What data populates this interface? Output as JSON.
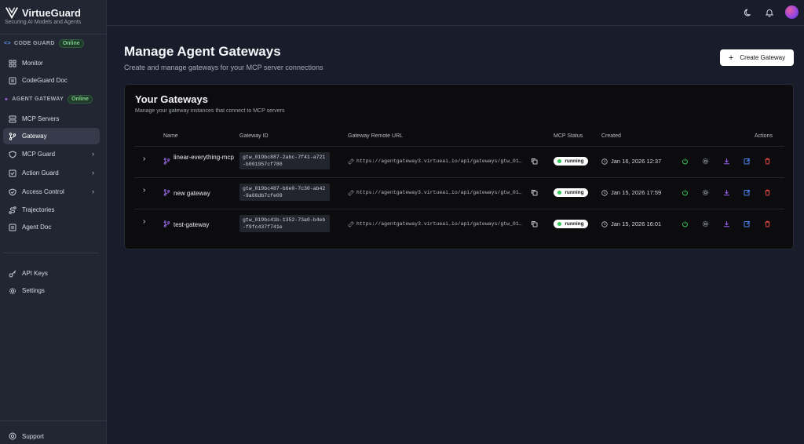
{
  "brand": {
    "name": "VirtueGuard",
    "tagline": "Securing AI Models and Agents"
  },
  "sidebar": {
    "code_guard": {
      "label": "CODE GUARD",
      "badge": "Online",
      "items": [
        {
          "label": "Monitor",
          "icon": "grid-icon"
        },
        {
          "label": "CodeGuard Doc",
          "icon": "document-icon"
        }
      ]
    },
    "agent_gateway": {
      "label": "AGENT GATEWAY",
      "badge": "Online",
      "items": [
        {
          "label": "MCP Servers",
          "icon": "server-icon"
        },
        {
          "label": "Gateway",
          "icon": "branch-icon",
          "active": true
        },
        {
          "label": "MCP Guard",
          "icon": "shield-icon",
          "expandable": true
        },
        {
          "label": "Action Guard",
          "icon": "square-check-icon",
          "expandable": true
        },
        {
          "label": "Access Control",
          "icon": "shield-check-icon",
          "expandable": true
        },
        {
          "label": "Trajectories",
          "icon": "route-icon"
        },
        {
          "label": "Agent Doc",
          "icon": "document-icon"
        }
      ]
    },
    "settings_items": [
      {
        "label": "API Keys",
        "icon": "key-icon"
      },
      {
        "label": "Settings",
        "icon": "gear-icon"
      }
    ],
    "support": {
      "label": "Support",
      "icon": "lifebuoy-icon"
    }
  },
  "header": {
    "title": "Manage Agent Gateways",
    "subtitle": "Create and manage gateways for your MCP server connections",
    "create_button": "Create Gateway"
  },
  "card": {
    "title": "Your Gateways",
    "subtitle": "Manage your gateway instances that connect to MCP servers",
    "columns": [
      "Name",
      "Gateway ID",
      "Gateway Remote URL",
      "MCP Status",
      "Created",
      "Actions"
    ],
    "rows": [
      {
        "name": "linear-everything-mcp",
        "gateway_id": "gtw_019bc887-2abc-7f41-a721-b001957cf780",
        "url": "https://agentgateway3.virtueai.io/api/gateways/gtw_01...",
        "status": "running",
        "created": "Jan 16, 2026 12:37"
      },
      {
        "name": "new gateway",
        "gateway_id": "gtw_019bc487-b6e0-7c30-ab42-9a66db7cfe09",
        "url": "https://agentgateway3.virtueai.io/api/gateways/gtw_01...",
        "status": "running",
        "created": "Jan 15, 2026 17:59"
      },
      {
        "name": "test-gateway",
        "gateway_id": "gtw_019bc41b-1352-73a0-b4eb-f9fc437f741e",
        "url": "https://agentgateway3.virtueai.io/api/gateways/gtw_01...",
        "status": "running",
        "created": "Jan 15, 2026 16:01"
      }
    ]
  },
  "colors": {
    "background": "#181c2b",
    "sidebar": "#222633",
    "card": "#0c0c0e",
    "accent_purple": "#a06ef0",
    "status_green": "#34c759",
    "danger": "#e04848",
    "edit_blue": "#4c86f2"
  }
}
